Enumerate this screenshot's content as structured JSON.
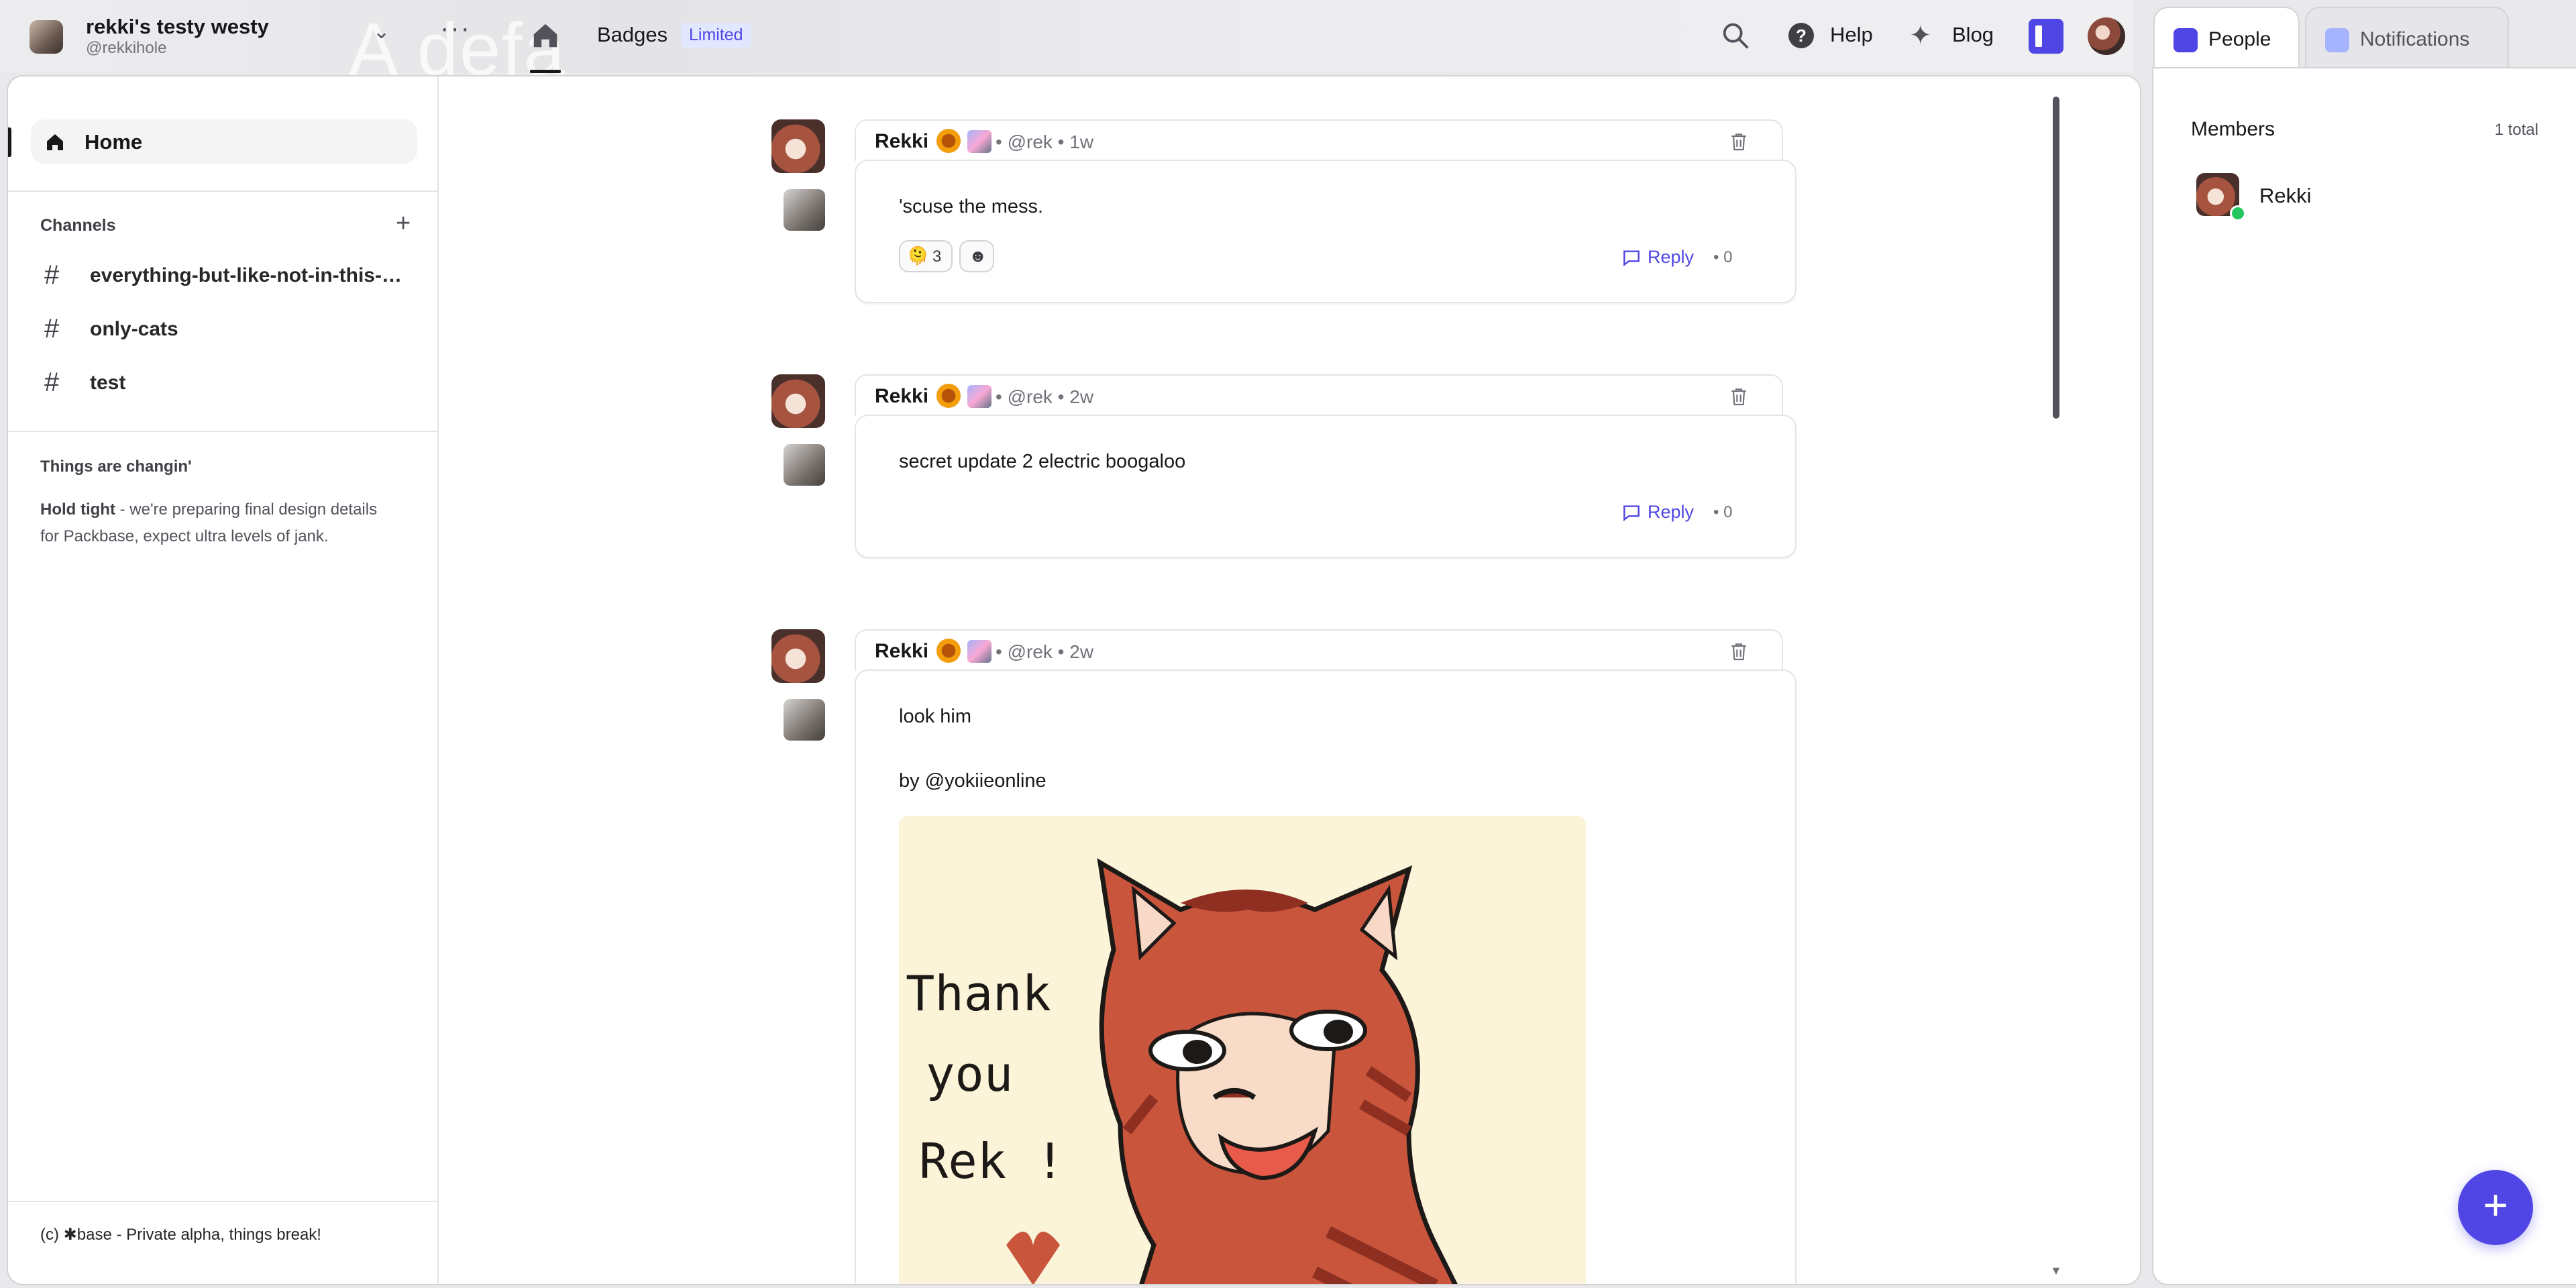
{
  "workspace": {
    "name": "rekki's testy westy",
    "handle": "@rekkihole",
    "background_text": "A defa"
  },
  "topbar": {
    "badges_label": "Badges",
    "badges_tag": "Limited",
    "help_label": "Help",
    "help_glyph": "?",
    "blog_label": "Blog",
    "blog_glyph": "✦",
    "more_glyph": "···",
    "chevron_glyph": "⌄"
  },
  "sidebar": {
    "home_label": "Home",
    "channels_title": "Channels",
    "add_glyph": "+",
    "channels": [
      {
        "name": "everything-but-like-not-in-this-place-or-something"
      },
      {
        "name": "only-cats"
      },
      {
        "name": "test"
      }
    ],
    "notice_title": "Things are changin'",
    "notice_bold": "Hold tight",
    "notice_text": " - we're preparing final design details for Packbase, expect ultra levels of jank.",
    "footer": "(c) ✱base - Private alpha, things break!"
  },
  "posts": [
    {
      "author": "Rekki",
      "meta": "• @rek • 1w",
      "lines": [
        "'scuse the mess."
      ],
      "reactions": [
        {
          "emoji": "🫠",
          "count": "3"
        },
        {
          "emoji": "☻",
          "count": ""
        }
      ],
      "reply_label": "Reply",
      "reply_count": "• 0"
    },
    {
      "author": "Rekki",
      "meta": "• @rek • 2w",
      "lines": [
        "secret update 2 electric boogaloo"
      ],
      "reply_label": "Reply",
      "reply_count": "• 0"
    },
    {
      "author": "Rekki",
      "meta": "• @rek • 2w",
      "lines": [
        "look him",
        "by @yokiieonline"
      ],
      "art_text": [
        "Thank",
        "you",
        "Rek !"
      ]
    }
  ],
  "right_panel": {
    "tabs": [
      {
        "label": "People"
      },
      {
        "label": "Notifications"
      }
    ],
    "members_title": "Members",
    "members_total": "1 total",
    "members": [
      {
        "name": "Rekki",
        "status": "online"
      }
    ]
  },
  "fab_glyph": "+",
  "colors": {
    "accent": "#4f46e5",
    "online": "#22c55e",
    "limited_bg": "#e0e7ff"
  }
}
